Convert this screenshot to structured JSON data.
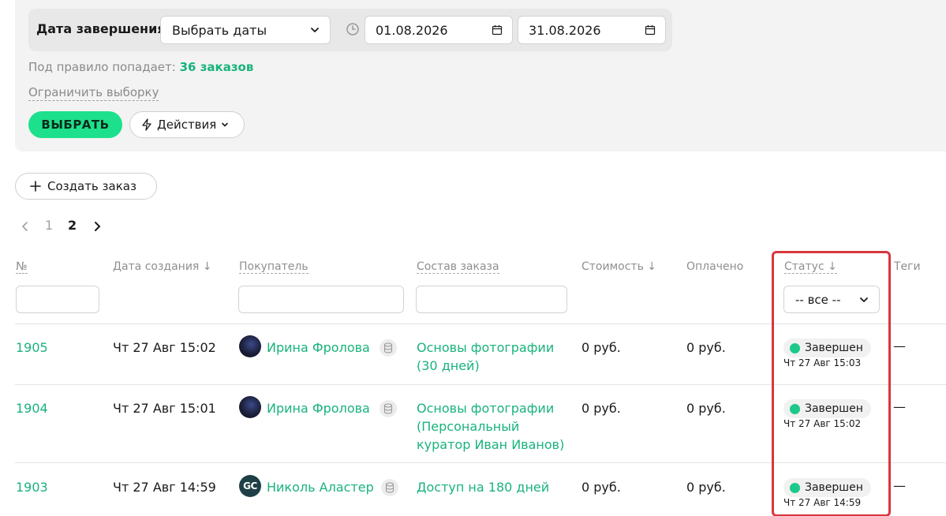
{
  "filter": {
    "date_label": "Дата завершения",
    "date_mode": "Выбрать даты",
    "date_from": "01.08.2026",
    "date_to": "31.08.2026",
    "rule_prefix": "Под правило попадает:",
    "rule_count": "36 заказов",
    "limit_link": "Ограничить выборку",
    "select_button": "ВЫБРАТЬ",
    "actions_button": "Действия"
  },
  "create_order_button": "Создать заказ",
  "pagination": {
    "prev": "‹",
    "pages": [
      "1",
      "2"
    ],
    "current": "2",
    "next": "›"
  },
  "table": {
    "headers": {
      "number": "№",
      "created": "Дата создания ↓",
      "buyer": "Покупатель",
      "contents": "Состав заказа",
      "cost": "Стоимость ↓",
      "paid": "Оплачено",
      "status": "Статус ↓",
      "tags": "Теги"
    },
    "status_filter": "-- все --",
    "rows": [
      {
        "number": "1905",
        "created": "Чт 27 Авг 15:02",
        "buyer": "Ирина Фролова",
        "contents": "Основы фотографии (30 дней)",
        "cost": "0 руб.",
        "paid": "0 руб.",
        "status": "Завершен",
        "status_time": "Чт 27 Авг 15:03",
        "tags": "—"
      },
      {
        "number": "1904",
        "created": "Чт 27 Авг 15:01",
        "buyer": "Ирина Фролова",
        "contents": "Основы фотографии (Персональный куратор Иван Иванов)",
        "cost": "0 руб.",
        "paid": "0 руб.",
        "status": "Завершен",
        "status_time": "Чт 27 Авг 15:02",
        "tags": "—"
      },
      {
        "number": "1903",
        "created": "Чт 27 Авг 14:59",
        "buyer": "Николь Аластер",
        "buyer_initials": "GC",
        "contents": "Доступ на 180 дней",
        "cost": "0 руб.",
        "paid": "0 руб.",
        "status": "Завершен",
        "status_time": "Чт 27 Авг 14:59",
        "tags": "—"
      }
    ]
  },
  "colors": {
    "accent_green": "#19b37c",
    "button_green": "#1de08c",
    "status_dot": "#1dc98a",
    "highlight": "#d9363e"
  }
}
